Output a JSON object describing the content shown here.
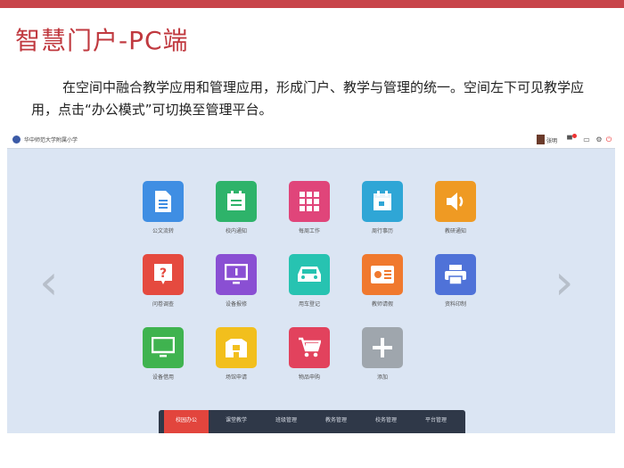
{
  "slide": {
    "title": "智慧门户-PC端",
    "description": "在空间中融合教学应用和管理应用，形成门户、教学与管理的统一。空间左下可见教学应用，点击“办公模式”可切换至管理平台。"
  },
  "portal": {
    "school_name": "华中师范大学附属小学",
    "user_name": "张明",
    "header_icons": [
      "message-icon",
      "card-icon",
      "gear-icon",
      "power-icon"
    ],
    "prev_arrow": "‹",
    "next_arrow": "›",
    "apps": [
      {
        "label": "公文流转",
        "icon": "document-icon",
        "color": "#3f8ee3"
      },
      {
        "label": "校内通知",
        "icon": "notice-icon",
        "color": "#2eb36a"
      },
      {
        "label": "每周工作",
        "icon": "grid-icon",
        "color": "#e0457a"
      },
      {
        "label": "周行事历",
        "icon": "calendar-icon",
        "color": "#2fa6d6"
      },
      {
        "label": "教研通知",
        "icon": "speaker-icon",
        "color": "#ef9a23"
      },
      {
        "label": "问卷调查",
        "icon": "question-icon",
        "color": "#e54a3f"
      },
      {
        "label": "设备报修",
        "icon": "monitor-info-icon",
        "color": "#8a4fd3"
      },
      {
        "label": "用车登记",
        "icon": "car-icon",
        "color": "#27c3b1"
      },
      {
        "label": "教师请假",
        "icon": "leave-card-icon",
        "color": "#f0792e"
      },
      {
        "label": "资料印制",
        "icon": "printer-icon",
        "color": "#4f72d8"
      },
      {
        "label": "设备借用",
        "icon": "monitor-icon",
        "color": "#3fb34f"
      },
      {
        "label": "场馆申请",
        "icon": "building-icon",
        "color": "#f2bf1d"
      },
      {
        "label": "物品申购",
        "icon": "cart-icon",
        "color": "#e2425d"
      },
      {
        "label": "添加",
        "icon": "plus-icon",
        "color": "#9fa6ad"
      }
    ],
    "dock": [
      {
        "label": "校园办公",
        "active": true
      },
      {
        "label": "课堂教学",
        "active": false
      },
      {
        "label": "班级管理",
        "active": false
      },
      {
        "label": "教务管理",
        "active": false
      },
      {
        "label": "校务管理",
        "active": false
      },
      {
        "label": "平台管理",
        "active": false
      }
    ]
  }
}
